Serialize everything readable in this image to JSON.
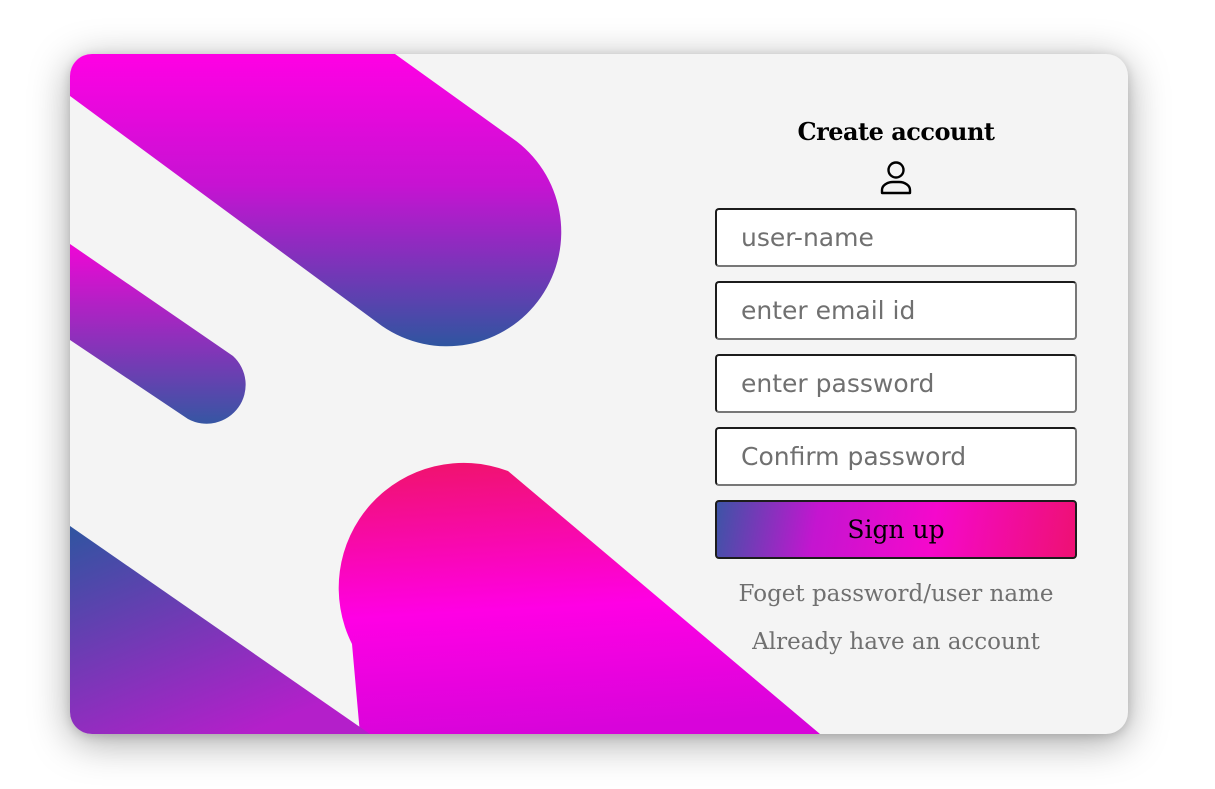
{
  "theme": {
    "card_background": "#f4f4f4",
    "gradient_magenta": "#ff00e4",
    "gradient_blue": "#2f55a0",
    "gradient_pink": "#f0106e"
  },
  "form": {
    "title": "Create account",
    "title_icon": "user-icon",
    "fields": {
      "username": {
        "placeholder": "user-name",
        "value": ""
      },
      "email": {
        "placeholder": "enter email id",
        "value": ""
      },
      "password": {
        "placeholder": "enter password",
        "value": ""
      },
      "confirm": {
        "placeholder": "Confirm password",
        "value": ""
      }
    },
    "submit_label": "Sign up",
    "forgot_link": "Foget password/user name",
    "login_link": "Already have an account"
  }
}
